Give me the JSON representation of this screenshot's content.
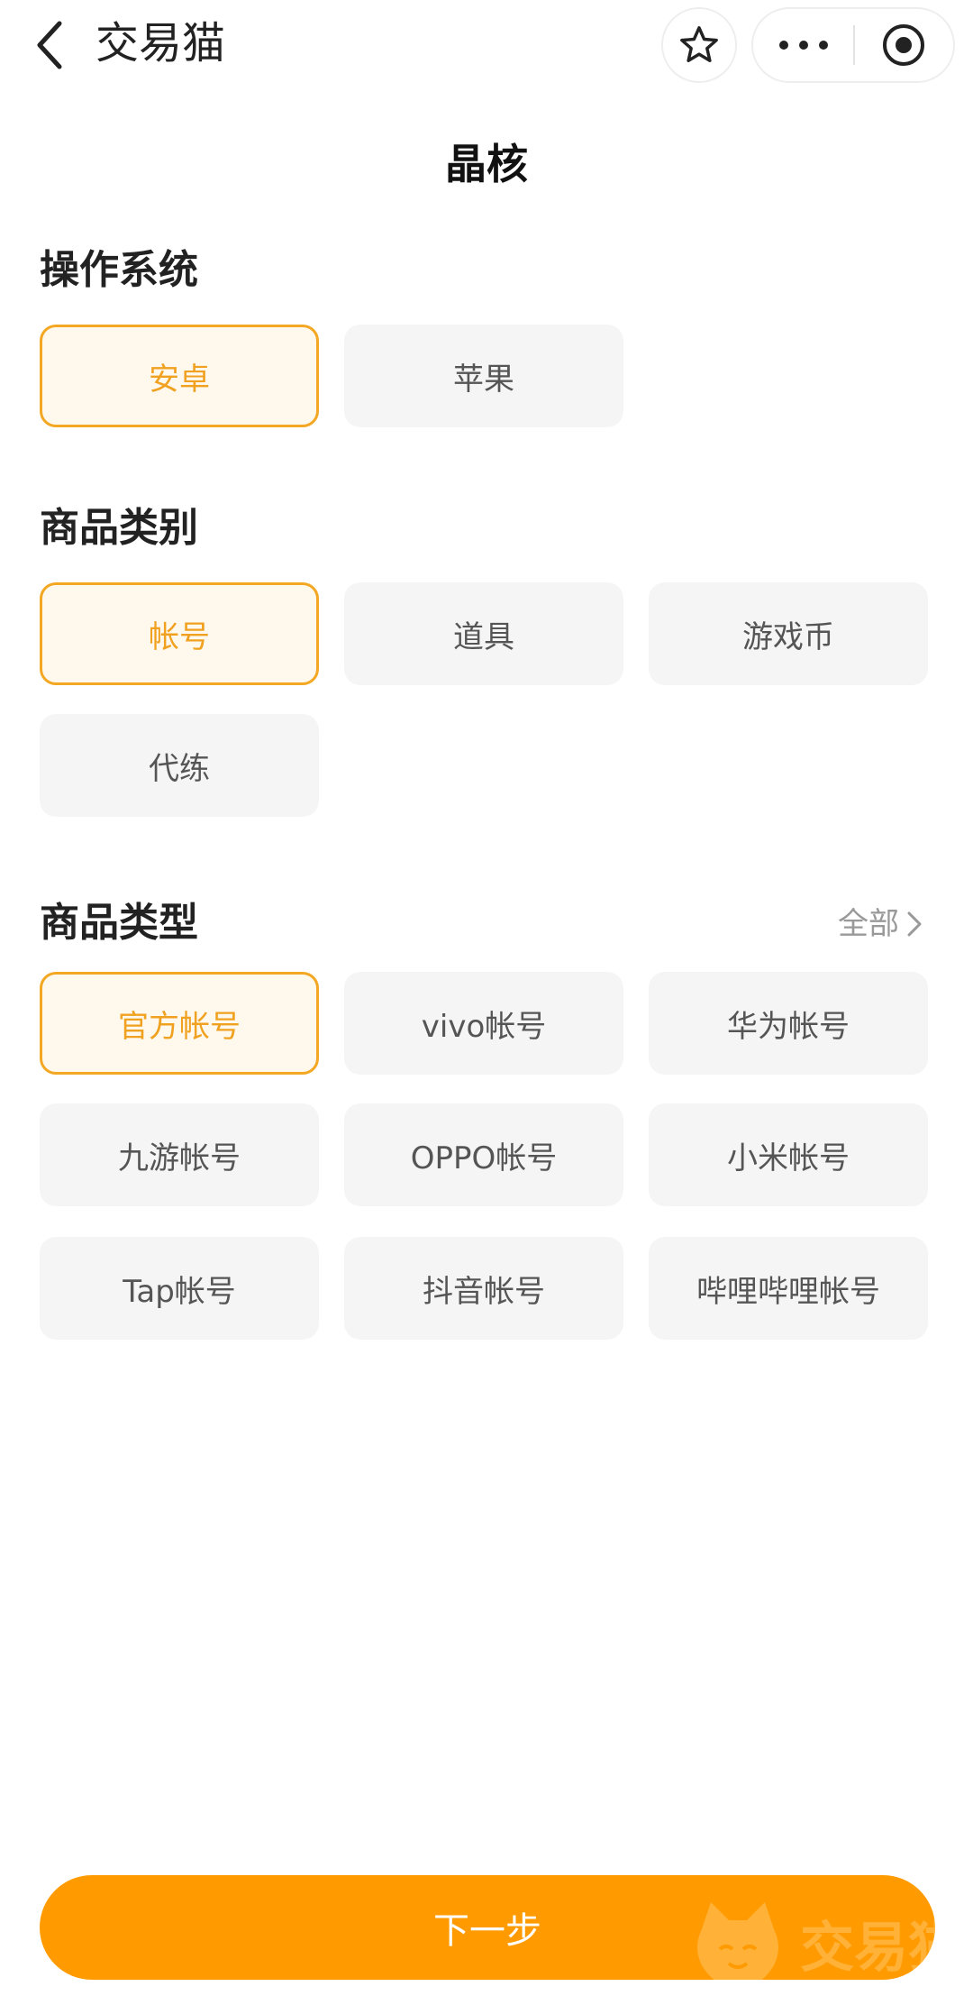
{
  "navbar": {
    "title": "交易猫"
  },
  "page_title": "晶核",
  "sections": {
    "os": {
      "title": "操作系统",
      "options": [
        "安卓",
        "苹果"
      ],
      "selected": "安卓"
    },
    "category": {
      "title": "商品类别",
      "options": [
        "帐号",
        "道具",
        "游戏币",
        "代练"
      ],
      "selected": "帐号"
    },
    "type": {
      "title": "商品类型",
      "all_label": "全部",
      "options": [
        "官方帐号",
        "vivo帐号",
        "华为帐号",
        "九游帐号",
        "OPPO帐号",
        "小米帐号",
        "Tap帐号",
        "抖音帐号",
        "哔哩哔哩帐号"
      ],
      "selected": "官方帐号"
    }
  },
  "next_button": "下一步",
  "watermark_text": "交易猫",
  "colors": {
    "accent": "#ff9b00",
    "selected_border": "#f3a723",
    "selected_text": "#f0a11f",
    "selected_bg": "#fff8ec",
    "chip_bg": "#f5f5f5"
  }
}
